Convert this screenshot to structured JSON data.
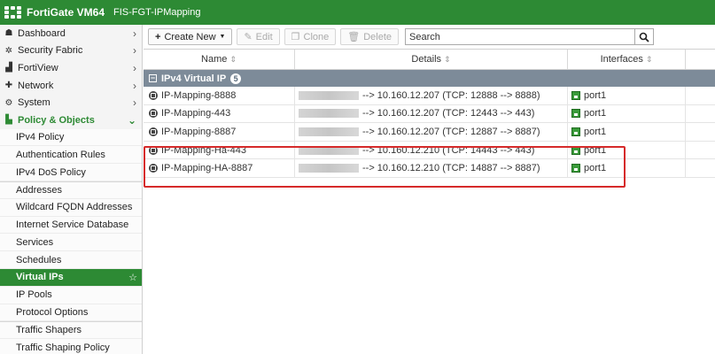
{
  "header": {
    "brand": "FortiGate VM64",
    "hostname": "FIS-FGT-IPMapping",
    "brand_color": "#2d8a34"
  },
  "sidebar": {
    "items": [
      {
        "label": "Dashboard",
        "icon": "dashboard-icon",
        "glyph": "☗"
      },
      {
        "label": "Security Fabric",
        "icon": "security-fabric-icon",
        "glyph": "✲"
      },
      {
        "label": "FortiView",
        "icon": "fortiview-icon",
        "glyph": "▟"
      },
      {
        "label": "Network",
        "icon": "network-icon",
        "glyph": "✚"
      },
      {
        "label": "System",
        "icon": "system-gear-icon",
        "glyph": "⚙"
      },
      {
        "label": "Policy & Objects",
        "icon": "policy-objects-icon",
        "glyph": "▙"
      }
    ],
    "subitems": [
      {
        "label": "IPv4 Policy"
      },
      {
        "label": "Authentication Rules"
      },
      {
        "label": "IPv4 DoS Policy"
      },
      {
        "label": "Addresses"
      },
      {
        "label": "Wildcard FQDN Addresses"
      },
      {
        "label": "Internet Service Database"
      },
      {
        "label": "Services"
      },
      {
        "label": "Schedules"
      },
      {
        "label": "Virtual IPs"
      },
      {
        "label": "IP Pools"
      },
      {
        "label": "Protocol Options"
      },
      {
        "label": "Traffic Shapers"
      },
      {
        "label": "Traffic Shaping Policy"
      }
    ],
    "active_subitem": "Virtual IPs"
  },
  "toolbar": {
    "create_new": "Create New",
    "edit": "Edit",
    "clone": "Clone",
    "delete": "Delete",
    "search_placeholder": "Search"
  },
  "table": {
    "columns": {
      "name": "Name",
      "details": "Details",
      "interfaces": "Interfaces"
    },
    "group": {
      "label": "IPv4 Virtual IP",
      "count": "5"
    },
    "rows": [
      {
        "name": "IP-Mapping-8888",
        "details": "--> 10.160.12.207 (TCP: 12888 --> 8888)",
        "interface": "port1"
      },
      {
        "name": "IP-Mapping-443",
        "details": "--> 10.160.12.207 (TCP: 12443 --> 443)",
        "interface": "port1"
      },
      {
        "name": "IP-Mapping-8887",
        "details": "--> 10.160.12.207 (TCP: 12887 --> 8887)",
        "interface": "port1"
      },
      {
        "name": "IP-Mapping-Ha-443",
        "details": "--> 10.160.12.210 (TCP: 14443 --> 443)",
        "interface": "port1"
      },
      {
        "name": "IP-Mapping-HA-8887",
        "details": "--> 10.160.12.210 (TCP: 14887 --> 8887)",
        "interface": "port1"
      }
    ]
  },
  "annotation": {
    "highlight_color": "#d62a2a"
  }
}
